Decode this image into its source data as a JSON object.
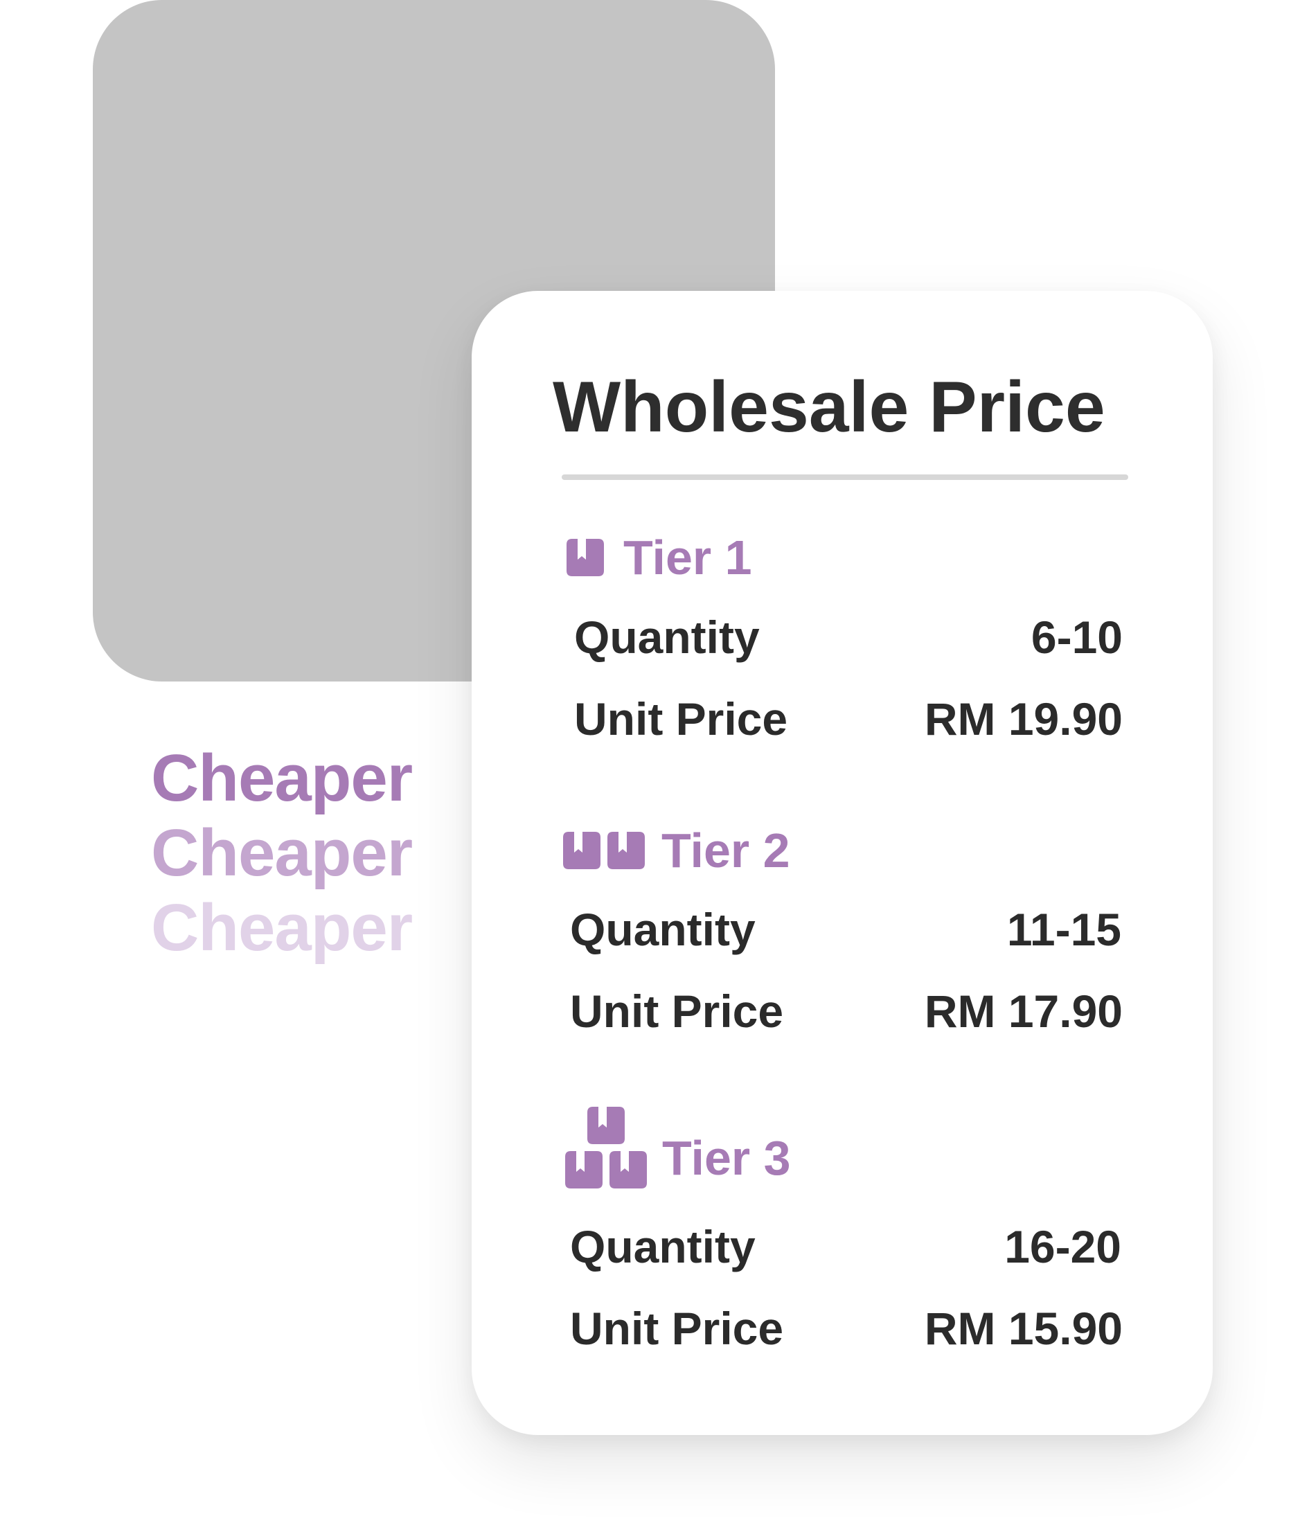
{
  "brand_colors": {
    "accent": "#a67bb5",
    "accent_mid": "#c4a6cf",
    "accent_light": "#e1d2e8",
    "text_dark": "#2b2b2b",
    "placeholder_gray": "#c4c4c4"
  },
  "cheaper_stack": [
    "Cheaper",
    "Cheaper",
    "Cheaper"
  ],
  "card": {
    "title": "Wholesale Price",
    "tiers": [
      {
        "label": "Tier 1",
        "icon": "single-box-icon",
        "quantity_label": "Quantity",
        "quantity_value": "6-10",
        "price_label": "Unit Price",
        "price_value": "RM 19.90"
      },
      {
        "label": "Tier 2",
        "icon": "two-boxes-icon",
        "quantity_label": "Quantity",
        "quantity_value": "11-15",
        "price_label": "Unit Price",
        "price_value": "RM 17.90"
      },
      {
        "label": "Tier 3",
        "icon": "stacked-boxes-icon",
        "quantity_label": "Quantity",
        "quantity_value": "16-20",
        "price_label": "Unit Price",
        "price_value": "RM 15.90"
      }
    ]
  }
}
